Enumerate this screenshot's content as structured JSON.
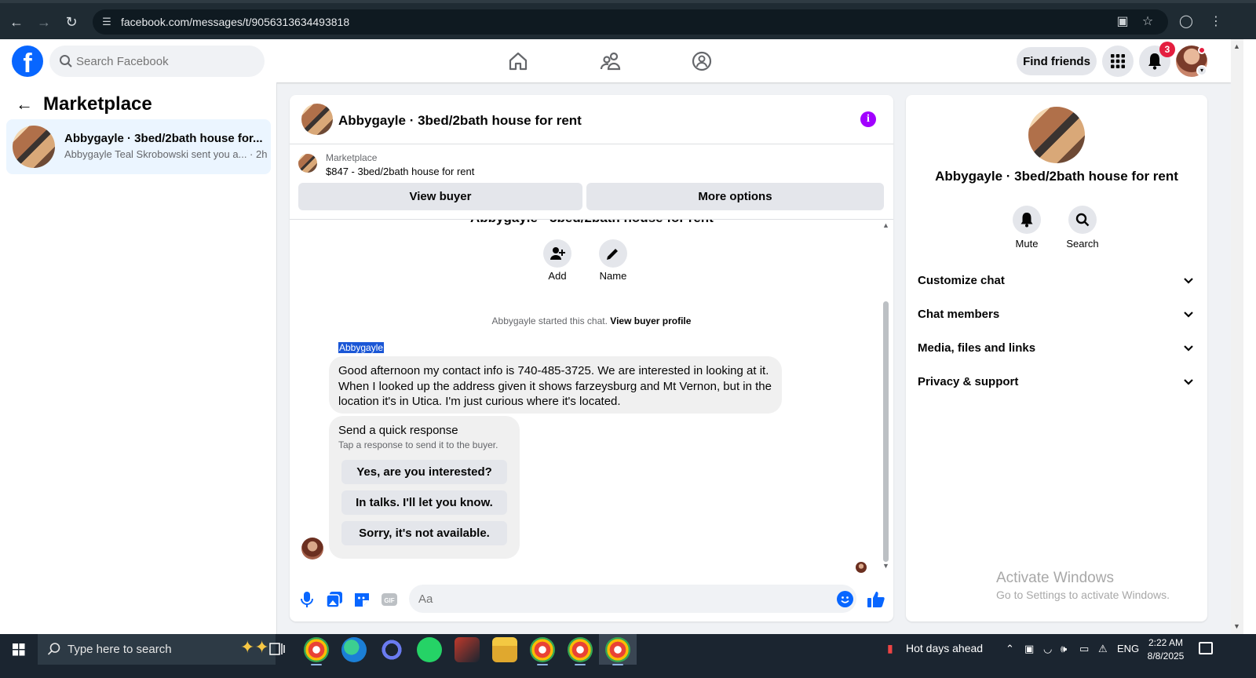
{
  "browser": {
    "url": "facebook.com/messages/t/9056313634493818"
  },
  "header": {
    "search_placeholder": "Search Facebook",
    "find_friends": "Find friends",
    "notification_count": "3"
  },
  "sidebar": {
    "title": "Marketplace",
    "conversation": {
      "title": "Abbygayle · 3bed/2bath house for...",
      "subtitle": "Abbygayle Teal Skrobowski sent you a... · 2h"
    }
  },
  "chat": {
    "title": "Abbygayle · 3bed/2bath house for rent",
    "marketplace_label": "Marketplace",
    "listing": "$847 - 3bed/2bath house for rent",
    "view_buyer": "View buyer",
    "more_options": "More options",
    "partial_group_name": "Abbygayle · 3bed/2bath house for rent",
    "actions": [
      {
        "label": "Add",
        "icon": "add-person-icon"
      },
      {
        "label": "Name",
        "icon": "pencil-icon"
      }
    ],
    "started_text": "Abbygayle started this chat.",
    "view_buyer_profile": "View buyer profile",
    "sender_name": "Abbygayle",
    "message": "Good afternoon my contact info is 740-485-3725. We are interested in looking at it. When I looked up the address given it shows farzeysburg and Mt Vernon, but in the location it's in Utica. I'm just curious where it's located.",
    "quick_response": {
      "title": "Send a quick response",
      "subtitle": "Tap a response to send it to the buyer.",
      "options": [
        "Yes, are you interested?",
        "In talks. I'll let you know.",
        "Sorry, it's not available."
      ]
    },
    "composer_placeholder": "Aa"
  },
  "details": {
    "title": "Abbygayle · 3bed/2bath house for rent",
    "actions": [
      {
        "label": "Mute",
        "icon": "bell-icon"
      },
      {
        "label": "Search",
        "icon": "search-icon"
      }
    ],
    "sections": [
      "Customize chat",
      "Chat members",
      "Media, files and links",
      "Privacy & support"
    ]
  },
  "watermark": {
    "line1": "Activate Windows",
    "line2": "Go to Settings to activate Windows."
  },
  "taskbar": {
    "search_text": "Type here to search",
    "weather": "Hot days ahead",
    "language": "ENG",
    "time": "2:22 AM",
    "date": "8/8/2025"
  },
  "colors": {
    "facebook_blue": "#0866ff",
    "info_purple": "#a100ff",
    "notification_red": "#e41e3f",
    "selected_conversation": "#ebf5ff"
  }
}
